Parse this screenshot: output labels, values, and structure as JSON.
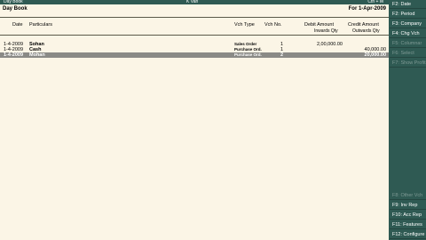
{
  "topbar": {
    "left": "Day Book",
    "center": "K Van",
    "right": "Ctrl + M"
  },
  "report": {
    "title": "Day Book",
    "period": "For 1-Apr-2009"
  },
  "columns": {
    "date": "Date",
    "particulars": "Particulars",
    "vch_type": "Vch Type",
    "vch_no": "Vch No.",
    "debit": "Debit Amount",
    "credit": "Credit Amount",
    "debit_sub": "Inwards Qty",
    "credit_sub": "Outwards Qty"
  },
  "rows": [
    {
      "date": "1-4-2009",
      "particulars": "Sohan",
      "vch_type": "Sales Order",
      "vch_no": "1",
      "debit": "2,00,000.00",
      "credit": ""
    },
    {
      "date": "1-4-2009",
      "particulars": "Cash",
      "vch_type": "Purchase Ord.",
      "vch_no": "1",
      "debit": "",
      "credit": "40,000.00"
    },
    {
      "date": "1-4-2009",
      "particulars": "Mohan",
      "vch_type": "Purchase Ord.",
      "vch_no": "2",
      "debit": "",
      "credit": "20,000.00"
    }
  ],
  "sidebar": {
    "buttons": [
      {
        "label": "F2: Date",
        "enabled": true
      },
      {
        "label": "F2: Period",
        "enabled": true
      },
      {
        "label": "F3: Company",
        "enabled": true
      },
      {
        "label": "F4: Chg Vch",
        "enabled": true
      },
      {
        "label": "F5: Columnar",
        "enabled": false
      },
      {
        "label": "F6: Select",
        "enabled": false
      },
      {
        "label": "F7: Show Profit",
        "enabled": false
      },
      {
        "label": "F8: Other Vch",
        "enabled": false
      },
      {
        "label": "F9: Inv Rep",
        "enabled": true
      },
      {
        "label": "F10: Acc Rep",
        "enabled": true
      },
      {
        "label": "F11: Features",
        "enabled": true
      },
      {
        "label": "F12: Configure",
        "enabled": true
      }
    ]
  },
  "colors": {
    "bar": "#2f5a53",
    "panel": "#fbf5e6",
    "selected_row": "#8a8a86"
  }
}
